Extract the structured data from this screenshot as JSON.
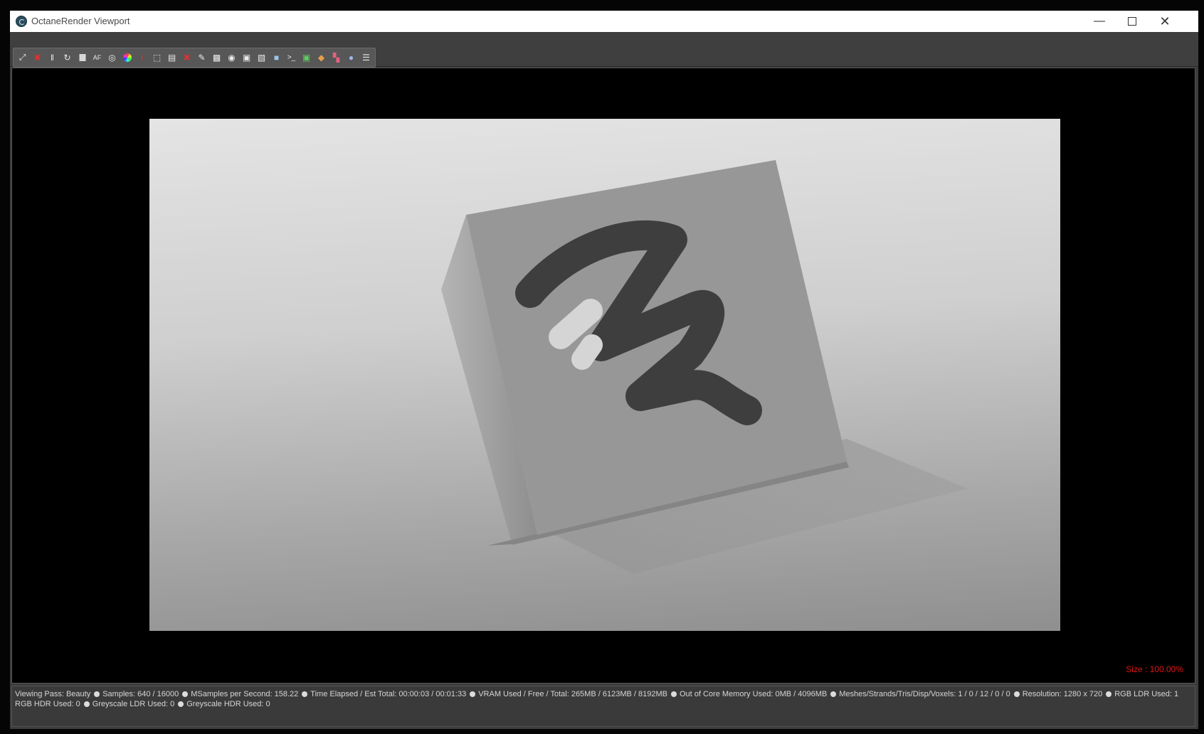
{
  "window": {
    "title": "OctaneRender Viewport"
  },
  "toolbar": {
    "icons": [
      "recenter-view-icon",
      "stop-render-icon",
      "pause-render-icon",
      "restart-render-icon",
      "stop-square-icon",
      "autofocus-icon",
      "world-coordinate-icon",
      "color-picker-icon",
      "info-icon",
      "region-render-icon",
      "film-region-icon",
      "lock-viewport-icon",
      "pick-material-icon",
      "clay-mode-icon",
      "camera-view-icon",
      "save-render-icon",
      "export-passes-icon",
      "cube-view-icon",
      "console-icon",
      "gpu-monitor-icon",
      "live-db-icon",
      "checker-icon",
      "network-icon",
      "settings-doc-icon"
    ]
  },
  "viewport": {
    "size_label": "Size : 100.00%",
    "resolution": [
      1280,
      720
    ]
  },
  "status": {
    "line1": [
      "Viewing Pass: Beauty",
      "Samples: 640  / 16000",
      "MSamples per Second: 158.22",
      "Time Elapsed / Est Total: 00:00:03 / 00:01:33",
      "VRAM Used / Free / Total: 265MB / 6123MB / 8192MB",
      "Out of Core Memory Used: 0MB / 4096MB",
      "Meshes/Strands/Tris/Disp/Voxels: 1 / 0 / 12 / 0 / 0",
      "Resolution: 1280 x 720",
      "RGB LDR Used: 1"
    ],
    "line2": [
      "RGB HDR Used: 0",
      "Greyscale LDR Used: 0",
      "Greyscale HDR Used: 0"
    ]
  },
  "colors": {
    "size_label": "#e21616",
    "accent": "#3c3c3c"
  }
}
